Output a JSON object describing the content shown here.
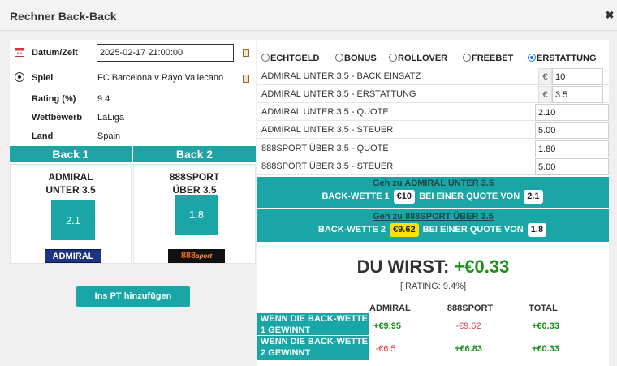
{
  "window": {
    "title": "Rechner Back-Back",
    "close_symbol": "✖"
  },
  "event": {
    "datetime_label": "Datum/Zeit",
    "datetime_value": "2025-02-17 21:00:00",
    "game_label": "Spiel",
    "game_value": "FC Barcelona v Rayo Vallecano",
    "rating_label": "Rating (%)",
    "rating_value": "9.4",
    "competition_label": "Wettbewerb",
    "competition_value": "LaLiga",
    "country_label": "Land",
    "country_value": "Spain"
  },
  "backs": [
    {
      "header": "Back 1",
      "line1": "ADMIRAL",
      "line2": "UNTER 3.5",
      "odds": "2.1",
      "logo": "ADMIRAL"
    },
    {
      "header": "Back 2",
      "line1": "888SPORT",
      "line2": "ÜBER 3.5",
      "odds": "1.8",
      "logo_main": "888",
      "logo_sub": "sport"
    }
  ],
  "add_pt_label": "Ins PT hinzufügen",
  "modes": [
    {
      "label": "ECHTGELD",
      "selected": false
    },
    {
      "label": "BONUS",
      "selected": false
    },
    {
      "label": "ROLLOVER",
      "selected": false
    },
    {
      "label": "FREEBET",
      "selected": false
    },
    {
      "label": "ERSTATTUNG",
      "selected": true
    }
  ],
  "fields": [
    {
      "label": "ADMIRAL UNTER 3.5 - BACK EINSATZ",
      "currency": "€",
      "value": "10"
    },
    {
      "label": "ADMIRAL UNTER 3.5 - ERSTATTUNG",
      "currency": "€",
      "value": "3.5"
    },
    {
      "label": "ADMIRAL UNTER 3.5 - QUOTE",
      "value": "2.10"
    },
    {
      "label": "ADMIRAL UNTER 3.5 - STEUER",
      "value": "5.00"
    },
    {
      "label": "888SPORT ÜBER 3.5  - QUOTE",
      "value": "1.80"
    },
    {
      "label": "888SPORT ÜBER 3.5 - STEUER",
      "value": "5.00"
    }
  ],
  "instructions": [
    {
      "link": "Geh zu ADMIRAL UNTER 3.5",
      "prefix": "BACK-WETTE 1",
      "stake": "€10",
      "middle": "BEI EINER QUOTE VON",
      "odds": "2.1"
    },
    {
      "link": "Geh zu 888SPORT ÜBER 3.5",
      "prefix": "BACK-WETTE 2",
      "stake": "€9.62",
      "middle": "BEI EINER QUOTE VON",
      "odds": "1.8"
    }
  ],
  "result": {
    "prefix": "DU WIRST:",
    "amount": "+€0.33",
    "rating": "[ RATING: 9.4%]"
  },
  "table": {
    "headers": [
      "ADMIRAL",
      "888SPORT",
      "TOTAL"
    ],
    "rows": [
      {
        "label": "WENN DIE BACK-WETTE 1 GEWINNT",
        "a": "+€9.95",
        "b": "-€9.62",
        "total": "+€0.33"
      },
      {
        "label": "WENN DIE BACK-WETTE 2 GEWINNT",
        "a": "-€6.5",
        "b": "+€6.83",
        "total": "+€0.33"
      }
    ]
  },
  "colors": {
    "teal": "#1aa6a6",
    "positive": "#1b8e1b",
    "negative": "#e04040",
    "highlight": "#ffe200"
  }
}
